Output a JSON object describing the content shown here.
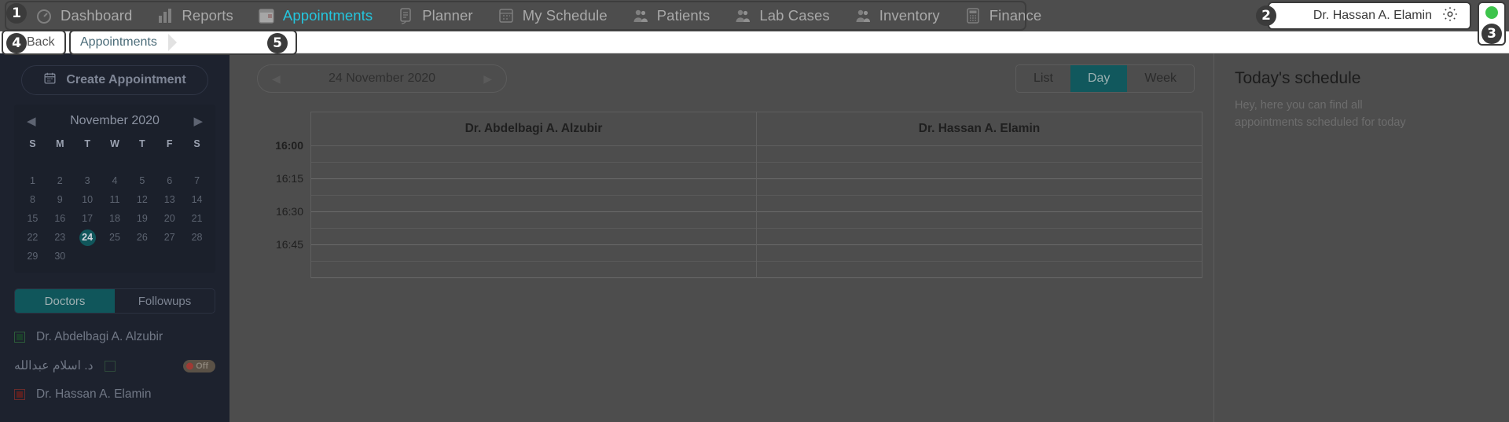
{
  "nav": {
    "items": [
      {
        "label": "Dashboard",
        "icon": "gauge-icon",
        "active": false
      },
      {
        "label": "Reports",
        "icon": "bar-chart-icon",
        "active": false
      },
      {
        "label": "Appointments",
        "icon": "calendar-icon",
        "active": true
      },
      {
        "label": "Planner",
        "icon": "clipboard-icon",
        "active": false
      },
      {
        "label": "My Schedule",
        "icon": "calendar-days-icon",
        "active": false
      },
      {
        "label": "Patients",
        "icon": "users-icon",
        "active": false
      },
      {
        "label": "Lab Cases",
        "icon": "users-icon",
        "active": false
      },
      {
        "label": "Inventory",
        "icon": "users-icon",
        "active": false
      },
      {
        "label": "Finance",
        "icon": "calculator-icon",
        "active": false
      }
    ]
  },
  "user": {
    "name": "Dr. Hassan A. Elamin",
    "settings_icon": "gear-icon",
    "status_color": "#3dc44b"
  },
  "breadcrumb": {
    "back_label": "Back",
    "current": "Appointments"
  },
  "annotations": {
    "badge1": "1",
    "badge2": "2",
    "badge3": "3",
    "badge4": "4",
    "badge5": "5"
  },
  "sidebar": {
    "create_label": "Create Appointment",
    "create_icon": "calendar-plus-icon",
    "calendar": {
      "month_year": "November  2020",
      "prev_icon": "chevron-left-icon",
      "next_icon": "chevron-right-icon",
      "dow": [
        "S",
        "M",
        "T",
        "W",
        "T",
        "F",
        "S"
      ],
      "weeks": [
        [
          "",
          "",
          "",
          "",
          "",
          "",
          ""
        ],
        [
          "1",
          "2",
          "3",
          "4",
          "5",
          "6",
          "7"
        ],
        [
          "8",
          "9",
          "10",
          "11",
          "12",
          "13",
          "14"
        ],
        [
          "15",
          "16",
          "17",
          "18",
          "19",
          "20",
          "21"
        ],
        [
          "22",
          "23",
          "24",
          "25",
          "26",
          "27",
          "28"
        ],
        [
          "29",
          "30",
          "",
          "",
          "",
          "",
          ""
        ]
      ],
      "selected_day": "24"
    },
    "tabs": [
      {
        "label": "Doctors",
        "active": true
      },
      {
        "label": "Followups",
        "active": false
      }
    ],
    "doctors": [
      {
        "name": "Dr. Abdelbagi A. Alzubir",
        "checkbox": "green",
        "rtl": false,
        "badge": ""
      },
      {
        "name": "د. اسلام عبدالله",
        "checkbox": "empty",
        "rtl": true,
        "badge": "Off"
      },
      {
        "name": "Dr. Hassan A. Elamin",
        "checkbox": "red",
        "rtl": false,
        "badge": ""
      }
    ]
  },
  "main": {
    "date_label": "24 November 2020",
    "prev_icon": "triangle-left-icon",
    "next_icon": "triangle-right-icon",
    "views": [
      {
        "label": "List",
        "active": false
      },
      {
        "label": "Day",
        "active": true
      },
      {
        "label": "Week",
        "active": false
      }
    ],
    "columns": [
      "Dr. Abdelbagi A. Alzubir",
      "Dr. Hassan A. Elamin"
    ],
    "times": [
      "16:00",
      "16:15",
      "16:30",
      "16:45"
    ]
  },
  "right_panel": {
    "title": "Today's schedule",
    "subtitle": "Hey, here you can find all appointments scheduled for today"
  }
}
